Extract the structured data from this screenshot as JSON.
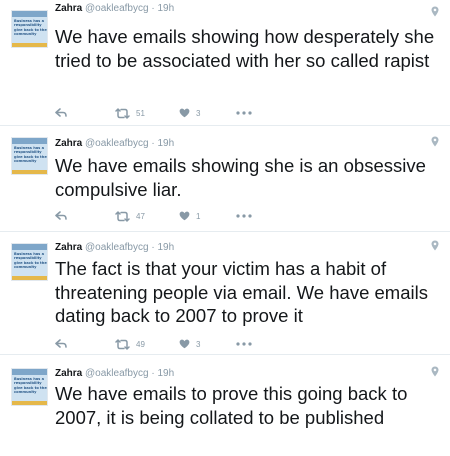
{
  "colors": {
    "action_gray": "#8899a6",
    "text": "#14171a",
    "divider": "#e6ecf0"
  },
  "tweets": [
    {
      "name": "Zahra",
      "handle": "@oakleafbycg",
      "separator": "·",
      "time": "19h",
      "text": "We have emails showing how desperately she tried to be associated with her so called rapist",
      "retweets": "51",
      "likes": "3",
      "avatar_text": "Business has a responsibility give back to the community"
    },
    {
      "name": "Zahra",
      "handle": "@oakleafbycg",
      "separator": "·",
      "time": "19h",
      "text": "We have emails showing she is an obsessive compulsive liar.",
      "retweets": "47",
      "likes": "1",
      "avatar_text": "Business has a responsibility give back to the community"
    },
    {
      "name": "Zahra",
      "handle": "@oakleafbycg",
      "separator": "·",
      "time": "19h",
      "text": "The fact is that your victim has a habit of threatening people via email. We have emails dating back to 2007 to prove it",
      "retweets": "49",
      "likes": "3",
      "avatar_text": "Business has a responsibility give back to the community"
    },
    {
      "name": "Zahra",
      "handle": "@oakleafbycg",
      "separator": "·",
      "time": "19h",
      "text": "We have emails to prove this going back to 2007, it is being collated to be published",
      "avatar_text": "Business has a responsibility give back to the community"
    }
  ]
}
